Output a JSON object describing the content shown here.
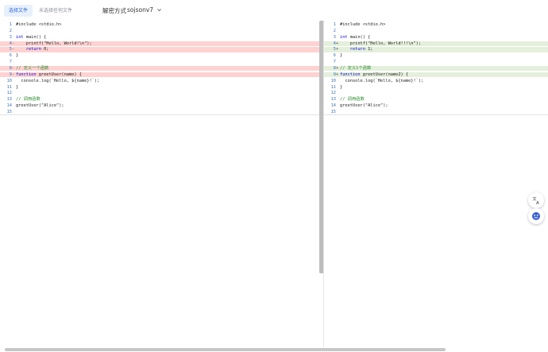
{
  "toolbar": {
    "select_file_label": "选择文件",
    "file_status": "未选择任何文件",
    "decode_label": "解密方式",
    "decode_value": "sojsonv7"
  },
  "left_pane": {
    "lines": [
      {
        "num": "1",
        "gutter": "",
        "state": "",
        "code": "#include <stdio.h>"
      },
      {
        "num": "2",
        "gutter": "",
        "state": "",
        "code": ""
      },
      {
        "num": "3",
        "gutter": "",
        "state": "",
        "code": "int main() {"
      },
      {
        "num": "4",
        "gutter": "-",
        "state": "del",
        "code": "    printf(\"Hello, World!\\n\");"
      },
      {
        "num": "5",
        "gutter": "-",
        "state": "del",
        "code": "    return 0;"
      },
      {
        "num": "6",
        "gutter": "",
        "state": "",
        "code": "}"
      },
      {
        "num": "7",
        "gutter": "",
        "state": "",
        "code": ""
      },
      {
        "num": "8",
        "gutter": "-",
        "state": "del",
        "code": "// 定义一个函数"
      },
      {
        "num": "9",
        "gutter": "-",
        "state": "del",
        "code": "function greetUser(name) {"
      },
      {
        "num": "10",
        "gutter": "",
        "state": "",
        "code": "  console.log(`Hello, ${name}!`);"
      },
      {
        "num": "11",
        "gutter": "",
        "state": "",
        "code": "}"
      },
      {
        "num": "12",
        "gutter": "",
        "state": "",
        "code": ""
      },
      {
        "num": "13",
        "gutter": "",
        "state": "",
        "code": "// 调用函数"
      },
      {
        "num": "14",
        "gutter": "",
        "state": "",
        "code": "greetUser(\"Alice\");"
      },
      {
        "num": "15",
        "gutter": "",
        "state": "",
        "code": ""
      }
    ]
  },
  "right_pane": {
    "lines": [
      {
        "num": "1",
        "gutter": "",
        "state": "",
        "code": "#include <stdio.h>"
      },
      {
        "num": "2",
        "gutter": "",
        "state": "",
        "code": ""
      },
      {
        "num": "3",
        "gutter": "",
        "state": "",
        "code": "int main() {"
      },
      {
        "num": "4",
        "gutter": "+",
        "state": "add",
        "code": "    printf(\"Hello, World!!!\\n\");"
      },
      {
        "num": "5",
        "gutter": "+",
        "state": "add",
        "code": "    return 1;"
      },
      {
        "num": "6",
        "gutter": "",
        "state": "",
        "code": "}"
      },
      {
        "num": "7",
        "gutter": "",
        "state": "",
        "code": ""
      },
      {
        "num": "8",
        "gutter": "+",
        "state": "add",
        "code": "// 定义1个函数"
      },
      {
        "num": "9",
        "gutter": "+",
        "state": "add",
        "code": "function greetUser(name2) {"
      },
      {
        "num": "10",
        "gutter": "",
        "state": "",
        "code": "  console.log(`Hello, ${name}!`);"
      },
      {
        "num": "11",
        "gutter": "",
        "state": "",
        "code": "}"
      },
      {
        "num": "12",
        "gutter": "",
        "state": "",
        "code": ""
      },
      {
        "num": "13",
        "gutter": "",
        "state": "",
        "code": "// 调用函数"
      },
      {
        "num": "14",
        "gutter": "",
        "state": "",
        "code": "greetUser(\"Alice\");"
      },
      {
        "num": "15",
        "gutter": "",
        "state": "",
        "code": ""
      }
    ]
  },
  "floating_buttons": {
    "translate_icon": "translate-icon",
    "assistant_icon": "smiley-icon"
  },
  "colors": {
    "accent": "#2e6bd6",
    "deleted_line": "#ffd2d2",
    "added_line": "#e4efdc"
  }
}
